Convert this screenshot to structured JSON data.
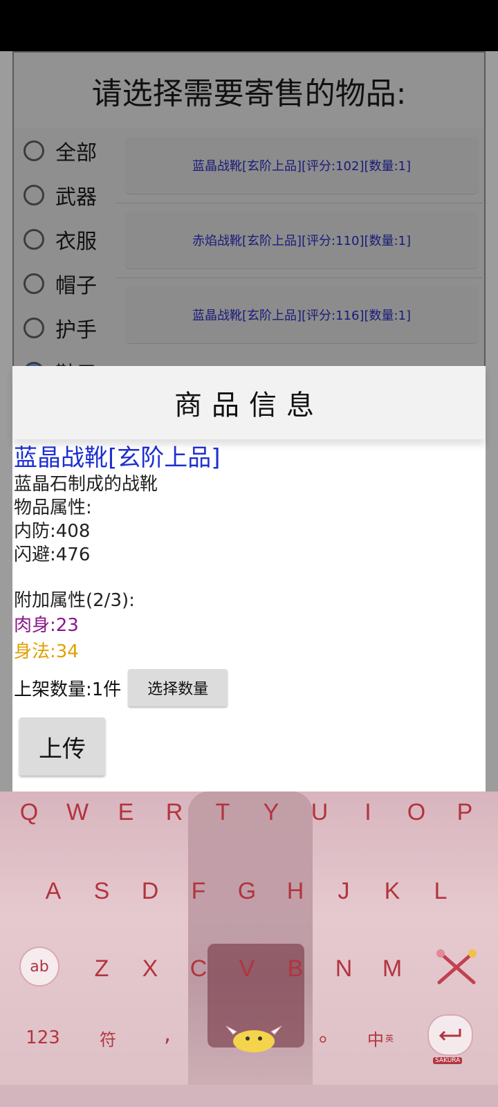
{
  "background_dialog": {
    "title": "请选择需要寄售的物品:",
    "categories": [
      {
        "label": "全部"
      },
      {
        "label": "武器"
      },
      {
        "label": "衣服"
      },
      {
        "label": "帽子"
      },
      {
        "label": "护手"
      },
      {
        "label": "鞋子"
      }
    ],
    "items": [
      {
        "label": "蓝晶战靴[玄阶上品][评分:102][数量:1]"
      },
      {
        "label": "赤焰战靴[玄阶上品][评分:110][数量:1]"
      },
      {
        "label": "蓝晶战靴[玄阶上品][评分:116][数量:1]"
      }
    ]
  },
  "info_dialog": {
    "header": "商品信息",
    "name": "蓝晶战靴[玄阶上品]",
    "description": "蓝晶石制成的战靴",
    "props_title": "物品属性:",
    "props": [
      "内防:408",
      "闪避:476"
    ],
    "extra_title": "附加属性(2/3):",
    "extra_props": [
      {
        "text": "肉身:23",
        "color": "#8a168a"
      },
      {
        "text": "身法:34",
        "color": "#e0a000"
      }
    ],
    "quantity_label": "上架数量:1件",
    "select_qty_button": "选择数量",
    "upload_button": "上传"
  },
  "keyboard": {
    "row1": [
      "Q",
      "W",
      "E",
      "R",
      "T",
      "Y",
      "U",
      "I",
      "O",
      "P"
    ],
    "row2": [
      "A",
      "S",
      "D",
      "F",
      "G",
      "H",
      "J",
      "K",
      "L"
    ],
    "row3": [
      "Z",
      "X",
      "C",
      "V",
      "B",
      "N",
      "M"
    ],
    "shift_label": "ab",
    "numbers_label": "123",
    "symbols_label": "符",
    "comma": ",",
    "period": "。",
    "lang_label": "中",
    "lang_sub": "英",
    "enter_sub": "SAKURA",
    "accent": "#b2343e"
  }
}
